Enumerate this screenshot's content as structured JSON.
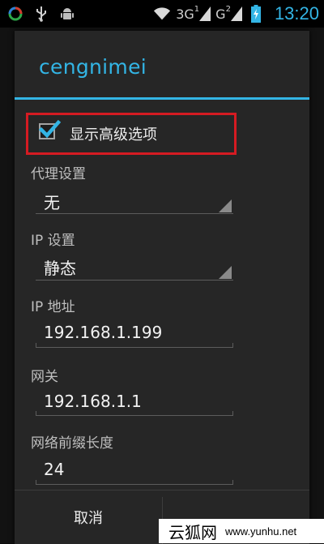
{
  "status_bar": {
    "icons": [
      "app-circle-icon",
      "usb-icon",
      "android-debug-icon",
      "wifi-icon",
      "signal-3g-icon",
      "signal-g-icon",
      "battery-charging-icon"
    ],
    "network_3g": "3G",
    "network_3g_sup": "1",
    "network_g": "G",
    "network_g_sup": "2",
    "time": "13:20"
  },
  "dialog": {
    "title": "cengnimei",
    "advanced_checkbox": {
      "label": "显示高级选项",
      "checked": true
    },
    "proxy": {
      "label": "代理设置",
      "value": "无"
    },
    "ip_settings": {
      "label": "IP 设置",
      "value": "静态"
    },
    "ip_address": {
      "label": "IP 地址",
      "value": "192.168.1.199"
    },
    "gateway": {
      "label": "网关",
      "value": "192.168.1.1"
    },
    "prefix_length": {
      "label": "网络前缀长度",
      "value": "24"
    },
    "buttons": {
      "cancel": "取消",
      "save": ""
    }
  },
  "colors": {
    "accent": "#33b5e5",
    "highlight_border": "#d51b22"
  },
  "watermark": {
    "text_cn": "云狐网",
    "url": "www.yunhu.net"
  }
}
